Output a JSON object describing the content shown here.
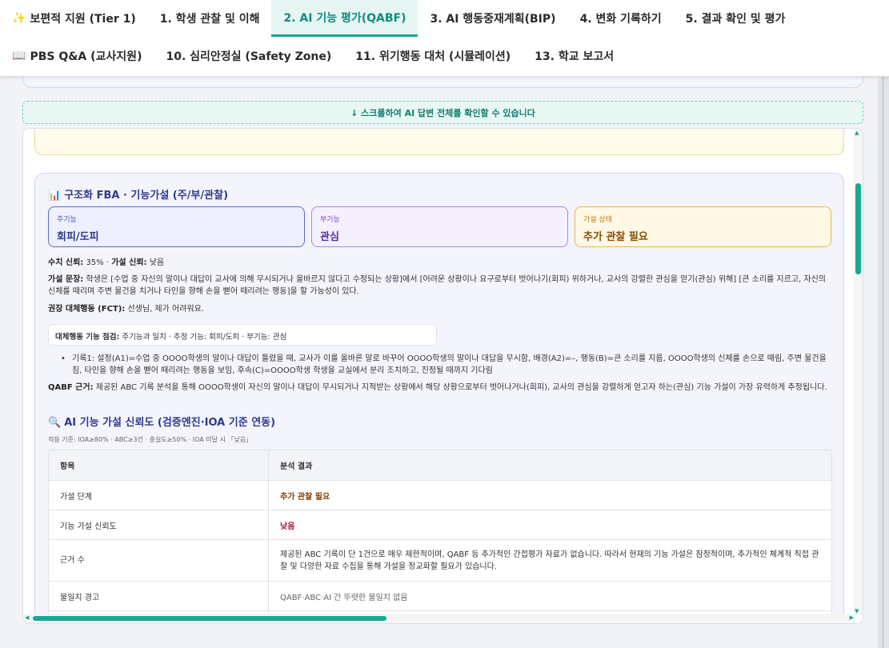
{
  "nav": {
    "row1": [
      {
        "icon": "sparkle-icon",
        "glyph": "✨",
        "label": "보편적 지원 (Tier 1)",
        "active": false
      },
      {
        "label": "1. 학생 관찰 및 이해",
        "active": false
      },
      {
        "label": "2. AI 기능 평가(QABF)",
        "active": true
      },
      {
        "label": "3. AI 행동중재계획(BIP)",
        "active": false
      },
      {
        "label": "4. 변화 기록하기",
        "active": false
      },
      {
        "label": "5. 결과 확인 및 평가",
        "active": false
      }
    ],
    "row2": [
      {
        "icon": "book-icon",
        "glyph": "📖",
        "label": "PBS Q&A (교사지원)",
        "active": false
      },
      {
        "label": "10. 심리안정실 (Safety Zone)",
        "active": false
      },
      {
        "label": "11. 위기행동 대처 (시뮬레이션)",
        "active": false
      },
      {
        "label": "13. 학교 보고서",
        "active": false
      }
    ]
  },
  "hint": "↓ 스크롤하여 AI 답변 전체를 확인할 수 있습니다",
  "fba": {
    "title_icon": "📊",
    "title": "구조화 FBA · 기능가설 (주/부/관찰)",
    "primary": {
      "label": "주기능",
      "value": "회피/도피"
    },
    "secondary": {
      "label": "부기능",
      "value": "관심"
    },
    "status": {
      "label": "가설 상태",
      "value": "추가 관찰 필요"
    },
    "confidence_label": "수치 신뢰:",
    "confidence_value": " 35% · ",
    "hypothesis_conf_label": "가설 신뢰:",
    "hypothesis_conf_value": " 낮음",
    "statement_label": "가설 문장:",
    "statement": " 학생은 [수업 중 자신의 말이나 대답이 교사에 의해 무시되거나 올바르지 않다고 수정되는 상황]에서 [어려운 상황이나 요구로부터 벗어나기(회피) 위하거나, 교사의 강렬한 관심을 얻기(관심) 위해] [큰 소리를 지르고, 자신의 신체를 때리며 주변 물건을 치거나 타인을 향해 손을 뻗어 때리려는 행동]을 할 가능성이 있다.",
    "fct_label": "권장 대체행동 (FCT):",
    "fct": " 선생님, 제가 어려워요.",
    "check_label": "대체행동 기능 점검:",
    "check": " 주기능과 일치 · 추정 기능: 회피/도피 · 부기능: 관심",
    "record": "기록1: 설정(A1)=수업 중 OOOO학생의 말이나 대답이 틀렸을 때, 교사가 이를 올바른 말로 바꾸어 OOOO학생의 말이나 대답을 무시함, 배경(A2)=–, 행동(B)=큰 소리를 지름, OOOO학생의 신체를 손으로 때림, 주변 물건을 침, 타인을 향해 손을 뻗어 때리려는 행동을 보임, 후속(C)=OOOO학생 학생을 교실에서 분리 조치하고, 진정될 때까지 기다림",
    "basis_label": "QABF 근거:",
    "basis": " 제공된 ABC 기록 분석을 통해 OOOO학생이 자신의 말이나 대답이 무시되거나 지적받는 상황에서 해당 상황으로부터 벗어나거나(회피), 교사의 관심을 강렬하게 얻고자 하는(관심) 기능 가설이 가장 유력하게 추정됩니다."
  },
  "confidence": {
    "icon": "🔍",
    "title": "AI 기능 가설 신뢰도 (검증엔진·IOA 기준 연동)",
    "subtitle": "적용 기준: IOA≥80% · ABC≥3건 · 충실도≥50% · IOA 미달 시 「낮음」",
    "headers": [
      "항목",
      "분석 결과"
    ],
    "rows": [
      {
        "key": "가설 단계",
        "value": "추가 관찰 필요"
      },
      {
        "key": "기능 가설 신뢰도",
        "value": "낮음"
      },
      {
        "key": "근거 수",
        "value": "제공된 ABC 기록이 단 1건으로 매우 제한적이며, QABF 등 추가적인 간접평가 자료가 없습니다. 따라서 현재의 기능 가설은 잠정적이며, 추가적인 체계적 직접 관찰 및 다양한 자료 수집을 통해 가설을 정교화할 필요가 있습니다."
      },
      {
        "key": "불일치 경고",
        "value": "QABF·ABC·AI 간 뚜렷한 불일치 없음"
      }
    ]
  }
}
